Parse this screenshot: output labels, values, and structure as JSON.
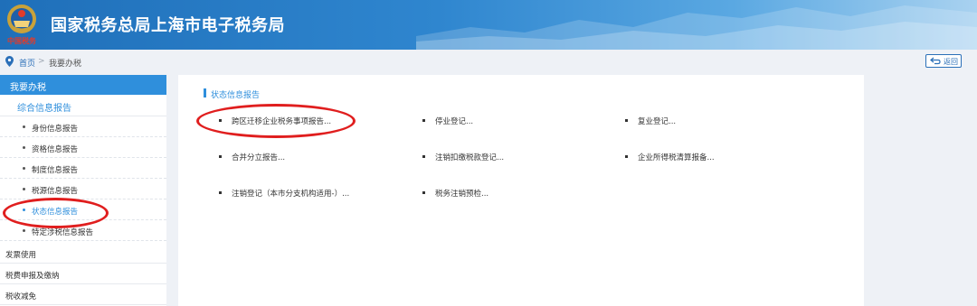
{
  "header": {
    "title": "国家税务总局上海市电子税务局",
    "emblem_caption": "中国税务"
  },
  "breadcrumb": {
    "home": "首页",
    "separator": ">",
    "current": "我要办税",
    "back_label": "返回"
  },
  "sidebar": {
    "head": "我要办税",
    "group": "综合信息报告",
    "items": [
      {
        "label": "身份信息报告"
      },
      {
        "label": "资格信息报告"
      },
      {
        "label": "制度信息报告"
      },
      {
        "label": "税源信息报告"
      },
      {
        "label": "状态信息报告"
      },
      {
        "label": "特定涉税信息报告"
      }
    ],
    "plain": [
      {
        "label": "发票使用"
      },
      {
        "label": "税费申报及缴纳"
      },
      {
        "label": "税收减免"
      }
    ]
  },
  "main": {
    "section_title": "状态信息报告",
    "items": [
      {
        "label": "跨区迁移企业税务事项报告..."
      },
      {
        "label": "停业登记..."
      },
      {
        "label": "复业登记..."
      },
      {
        "label": "合并分立报告..."
      },
      {
        "label": "注销扣缴税款登记..."
      },
      {
        "label": "企业所得税清算报备..."
      },
      {
        "label": "注销登记（本市分支机构适用-）..."
      },
      {
        "label": "税务注销预检..."
      }
    ]
  },
  "colors": {
    "accent": "#2f8fdc",
    "highlight": "#e01e1e"
  }
}
